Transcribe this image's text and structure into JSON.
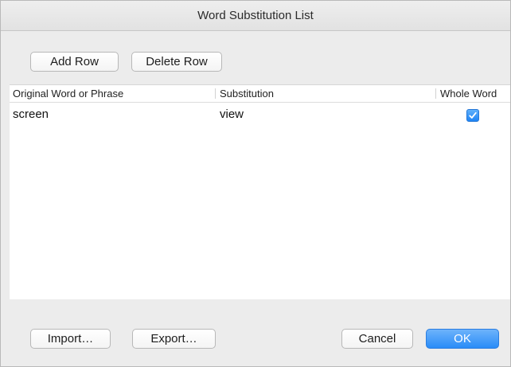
{
  "window": {
    "title": "Word Substitution List"
  },
  "toolbar": {
    "add_row_label": "Add Row",
    "delete_row_label": "Delete Row"
  },
  "table": {
    "columns": [
      "Original Word or Phrase",
      "Substitution",
      "Whole Word"
    ],
    "rows": [
      {
        "original": "screen",
        "substitution": "view",
        "whole_word": true
      }
    ]
  },
  "footer": {
    "import_label": "Import…",
    "export_label": "Export…",
    "cancel_label": "Cancel",
    "ok_label": "OK"
  },
  "colors": {
    "accent": "#2a8cf7"
  },
  "icons": {
    "whole_word_check": "checkmark-icon"
  }
}
